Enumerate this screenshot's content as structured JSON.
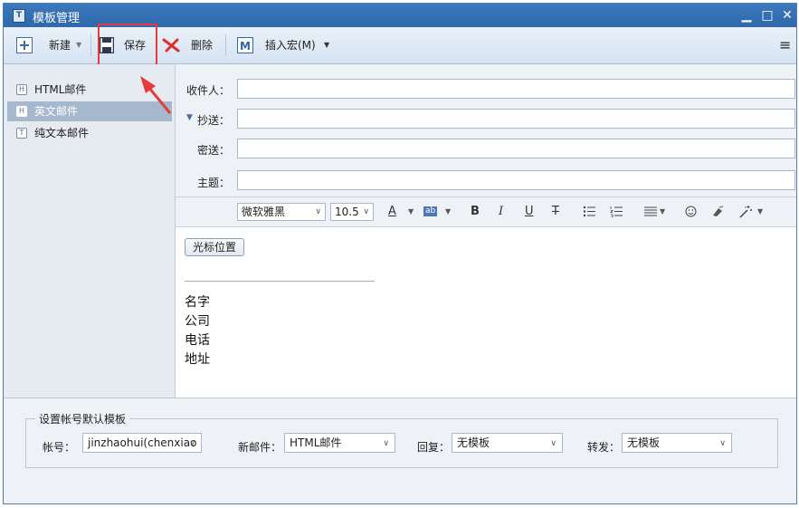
{
  "window": {
    "title": "模板管理",
    "minimize": "▁",
    "maximize": "□",
    "close": "✕",
    "app_icon": "T"
  },
  "toolbar": {
    "new_label": "新建",
    "save_label": "保存",
    "delete_label": "删除",
    "insert_macro_label": "插入宏(M)",
    "menu_icon": "≡"
  },
  "templates": [
    {
      "icon": "H",
      "label": "HTML邮件"
    },
    {
      "icon": "H",
      "label": "英文邮件"
    },
    {
      "icon": "T",
      "label": "纯文本邮件"
    }
  ],
  "header": {
    "to_label": "收件人：",
    "cc_label": "抄送：",
    "bcc_label": "密送：",
    "subject_label": "主题：",
    "cc_toggle": "▼",
    "to_value": "",
    "cc_value": "",
    "bcc_value": "",
    "subject_value": ""
  },
  "format": {
    "font": "微软雅黑",
    "size": "10.5",
    "font_color_icon": "A",
    "bg_color_icon": "ab",
    "bold": "B",
    "italic": "I",
    "underline": "U",
    "strike": "T"
  },
  "editor": {
    "cursor_button": "光标位置",
    "signature_lines": [
      "名字",
      "公司",
      "电话",
      "地址"
    ]
  },
  "defaults": {
    "legend": "设置帐号默认模板",
    "account_label": "帐号：",
    "account_value": "jinzhaohui(chenxiao",
    "new_mail_label": "新邮件：",
    "new_mail_value": "HTML邮件",
    "reply_label": "回复：",
    "reply_value": "无模板",
    "forward_label": "转发：",
    "forward_value": "无模板"
  },
  "colors": {
    "title_bar": "#3a74b8",
    "selection": "#a6b8ce",
    "highlight_box": "#e53b3b"
  }
}
